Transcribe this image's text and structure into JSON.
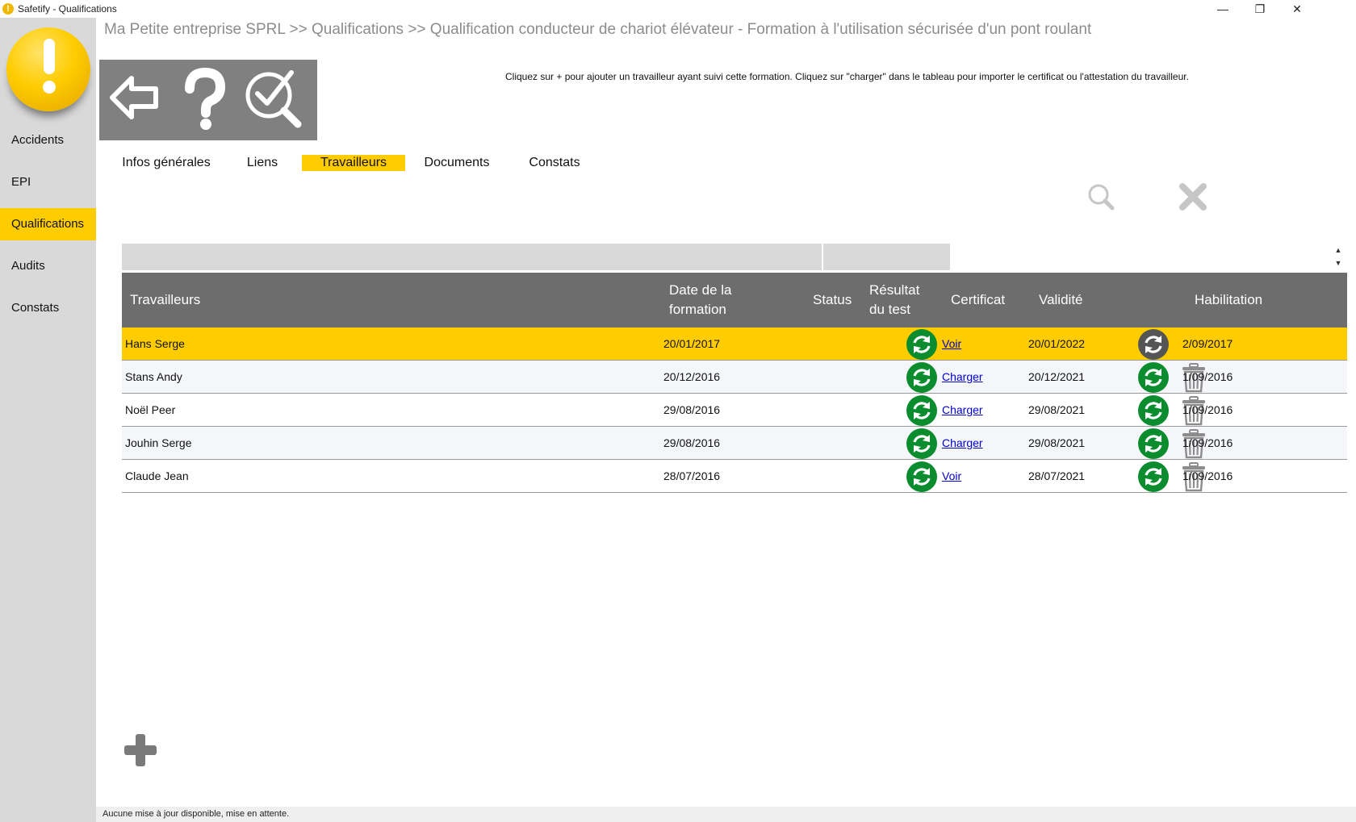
{
  "window": {
    "title": "Safetify - Qualifications",
    "app_icon_glyph": "!",
    "minimize_glyph": "—",
    "restore_glyph": "❐",
    "close_glyph": "✕"
  },
  "sidebar": {
    "items": [
      {
        "label": "Accidents",
        "active": false
      },
      {
        "label": "EPI",
        "active": false
      },
      {
        "label": "Qualifications",
        "active": true
      },
      {
        "label": "Audits",
        "active": false
      },
      {
        "label": "Constats",
        "active": false
      }
    ]
  },
  "breadcrumb": "Ma Petite entreprise SPRL >> Qualifications >> Qualification conducteur de chariot élévateur - Formation à l'utilisation sécurisée d'un pont roulant",
  "toolbar": {
    "icons": [
      "back-arrow-icon",
      "help-icon",
      "search-check-icon"
    ]
  },
  "instruction": "Cliquez sur + pour ajouter un travailleur ayant suivi cette formation. Cliquez sur \"charger\" dans le tableau pour importer le certificat ou l'attestation du travailleur.",
  "tabs": [
    {
      "label": "Infos générales",
      "active": false
    },
    {
      "label": "Liens",
      "active": false
    },
    {
      "label": "Travailleurs",
      "active": true
    },
    {
      "label": "Documents",
      "active": false
    },
    {
      "label": "Constats",
      "active": false
    }
  ],
  "scroll": {
    "up": "▲",
    "down": "▼"
  },
  "table": {
    "headers": {
      "workers": "Travailleurs",
      "date_line1": "Date de la",
      "date_line2": "formation",
      "status": "Status",
      "result_line1": "Résultat",
      "result_line2": "du test",
      "certificate": "Certificat",
      "validity": "Validité",
      "habilitation": "Habilitation"
    },
    "rows": [
      {
        "name": "Hans Serge",
        "date": "20/01/2017",
        "status": "",
        "certificate": "Voir",
        "validity": "20/01/2022",
        "habilitation": "2/09/2017",
        "selected": true
      },
      {
        "name": "Stans Andy",
        "date": "20/12/2016",
        "status": "",
        "certificate": "Charger",
        "validity": "20/12/2021",
        "habilitation": "1/09/2016",
        "selected": false
      },
      {
        "name": "Noël Peer",
        "date": "29/08/2016",
        "status": "",
        "certificate": "Charger",
        "validity": "29/08/2021",
        "habilitation": "1/09/2016",
        "selected": false
      },
      {
        "name": "Jouhin Serge",
        "date": "29/08/2016",
        "status": "",
        "certificate": "Charger",
        "validity": "29/08/2021",
        "habilitation": "1/09/2016",
        "selected": false
      },
      {
        "name": "Claude Jean",
        "date": "28/07/2016",
        "status": "",
        "certificate": "Voir",
        "validity": "28/07/2021",
        "habilitation": "1/09/2016",
        "selected": false
      }
    ]
  },
  "status_bar": "Aucune mise à jour disponible, mise en attente.",
  "colors": {
    "accent": "#ffcc00",
    "sidebar": "#d9d9d9",
    "header": "#6d6d6d",
    "refresh_green": "#0a8c2f",
    "refresh_gray": "#555555",
    "trash_gray": "#8c8c8c"
  }
}
